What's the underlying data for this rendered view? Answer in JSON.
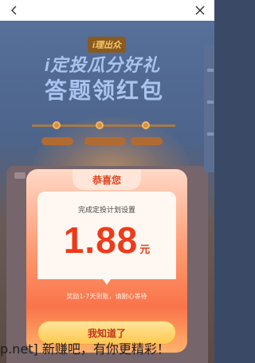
{
  "nav": {
    "back_icon": "chevron-left-icon",
    "close_icon": "close-icon"
  },
  "background": {
    "event_logo": "i理出众",
    "banner_line1": "i定投瓜分好礼",
    "banner_line2": "答题领红包"
  },
  "dialog": {
    "title": "恭喜您",
    "subtitle": "完成定投计划设置",
    "amount": "1.88",
    "unit": "元",
    "note": "奖励1-7天到账，请耐心等待",
    "button_label": "我知道了"
  },
  "watermark": "p.net] 新赚吧，有你更精彩！",
  "colors": {
    "accent": "#ef3a1a",
    "button": "#ffc850",
    "nav_bg": "#ffffff"
  }
}
